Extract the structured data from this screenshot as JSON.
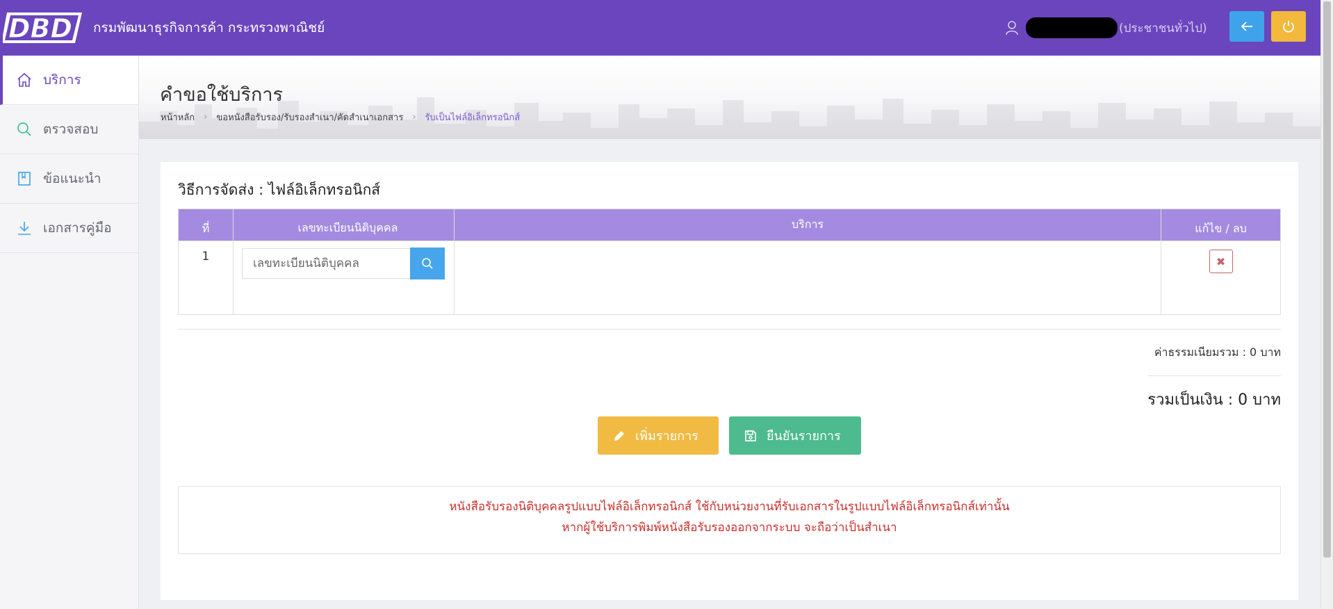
{
  "header": {
    "logo_text": "DBD",
    "agency_name": "กรมพัฒนาธุรกิจการค้า กระทรวงพาณิชย์",
    "user_role": "(ประชาชนทั่วไป)",
    "back_icon": "arrow-left-icon",
    "power_icon": "power-icon",
    "colors": {
      "bar": "#6a45bd",
      "back_button": "#3fa3ea",
      "power_button": "#f2b93d"
    }
  },
  "sidebar": {
    "items": [
      {
        "label": "บริการ",
        "icon": "home-icon",
        "active": true
      },
      {
        "label": "ตรวจสอบ",
        "icon": "search-icon",
        "active": false
      },
      {
        "label": "ข้อแนะนำ",
        "icon": "book-icon",
        "active": false
      },
      {
        "label": "เอกสารคู่มือ",
        "icon": "download-icon",
        "active": false
      }
    ]
  },
  "page": {
    "title": "คำขอใช้บริการ",
    "breadcrumb": [
      "หน้าหลัก",
      "ขอหนังสือรับรอง/รับรองสำเนา/คัดสำเนาเอกสาร",
      "รับเป็นไฟล์อิเล็กทรอนิกส์"
    ]
  },
  "form": {
    "method_label": "วิธีการจัดส่ง : ไฟล์อิเล็กทรอนิกส์",
    "table": {
      "headers": [
        "ที่",
        "เลขทะเบียนนิติบุคคล",
        "บริการ",
        "แก้ไข / ลบ"
      ],
      "rows": [
        {
          "no": "1",
          "reg_placeholder": "เลขทะเบียนนิติบุคคล",
          "service": "",
          "delete_symbol": "✖"
        }
      ]
    },
    "fee_total": "ค่าธรรมเนียมรวม : 0 บาท",
    "grand_total": "รวมเป็นเงิน : 0 บาท",
    "add_button": "เพิ่มรายการ",
    "confirm_button": "ยืนยันรายการ",
    "notice_line1": "หนังสือรับรองนิติบุคคลรูปแบบไฟล์อิเล็กทรอนิกส์ ใช้กับหน่วยงานที่รับเอกสารในรูปแบบไฟล์อิเล็กทรอนิกส์เท่านั้น",
    "notice_line2": "หากผู้ใช้บริการพิมพ์หนังสือรับรองออกจากระบบ จะถือว่าเป็นสำเนา"
  }
}
